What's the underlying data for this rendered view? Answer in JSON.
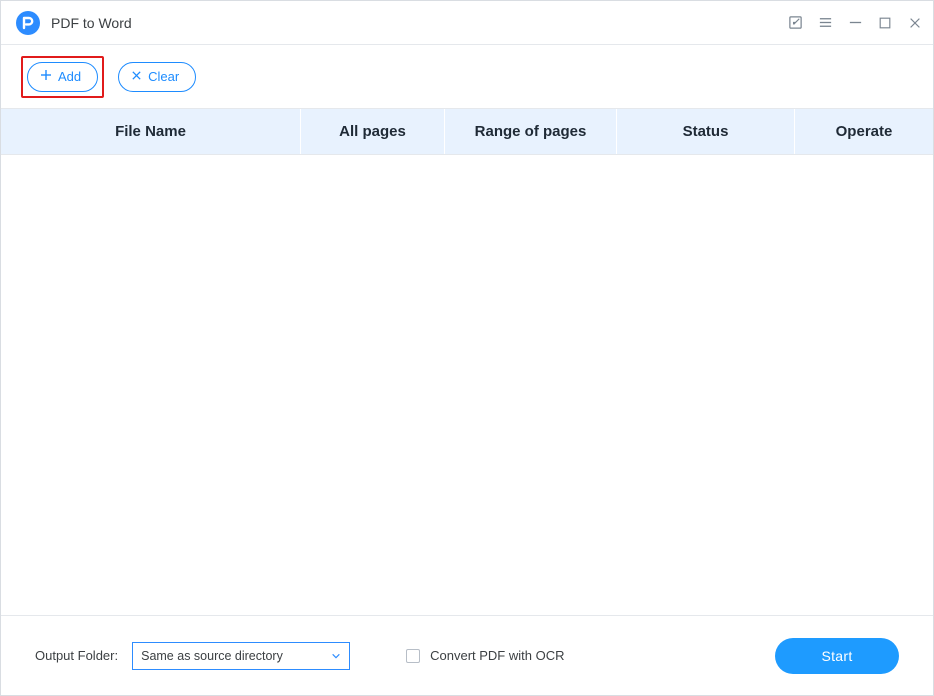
{
  "titlebar": {
    "title": "PDF to Word"
  },
  "toolbar": {
    "add_label": "Add",
    "clear_label": "Clear"
  },
  "table": {
    "headers": {
      "filename": "File Name",
      "all_pages": "All pages",
      "range": "Range of pages",
      "status": "Status",
      "operate": "Operate"
    },
    "rows": []
  },
  "footer": {
    "output_folder_label": "Output Folder:",
    "output_folder_value": "Same as source directory",
    "ocr_label": "Convert PDF with OCR",
    "ocr_checked": false,
    "start_label": "Start"
  },
  "icons": {
    "logo": "pdf-app-logo",
    "edit": "edit-icon",
    "menu": "menu-icon",
    "minimize": "minimize-icon",
    "maximize": "maximize-icon",
    "close": "close-icon",
    "plus": "plus-icon",
    "x-small": "x-small-icon",
    "chevron-down": "chevron-down-icon"
  },
  "colors": {
    "accent": "#1e8cff",
    "header_bg": "#e8f2fe",
    "highlight": "#e11b1b",
    "start_btn": "#1e9bff"
  }
}
